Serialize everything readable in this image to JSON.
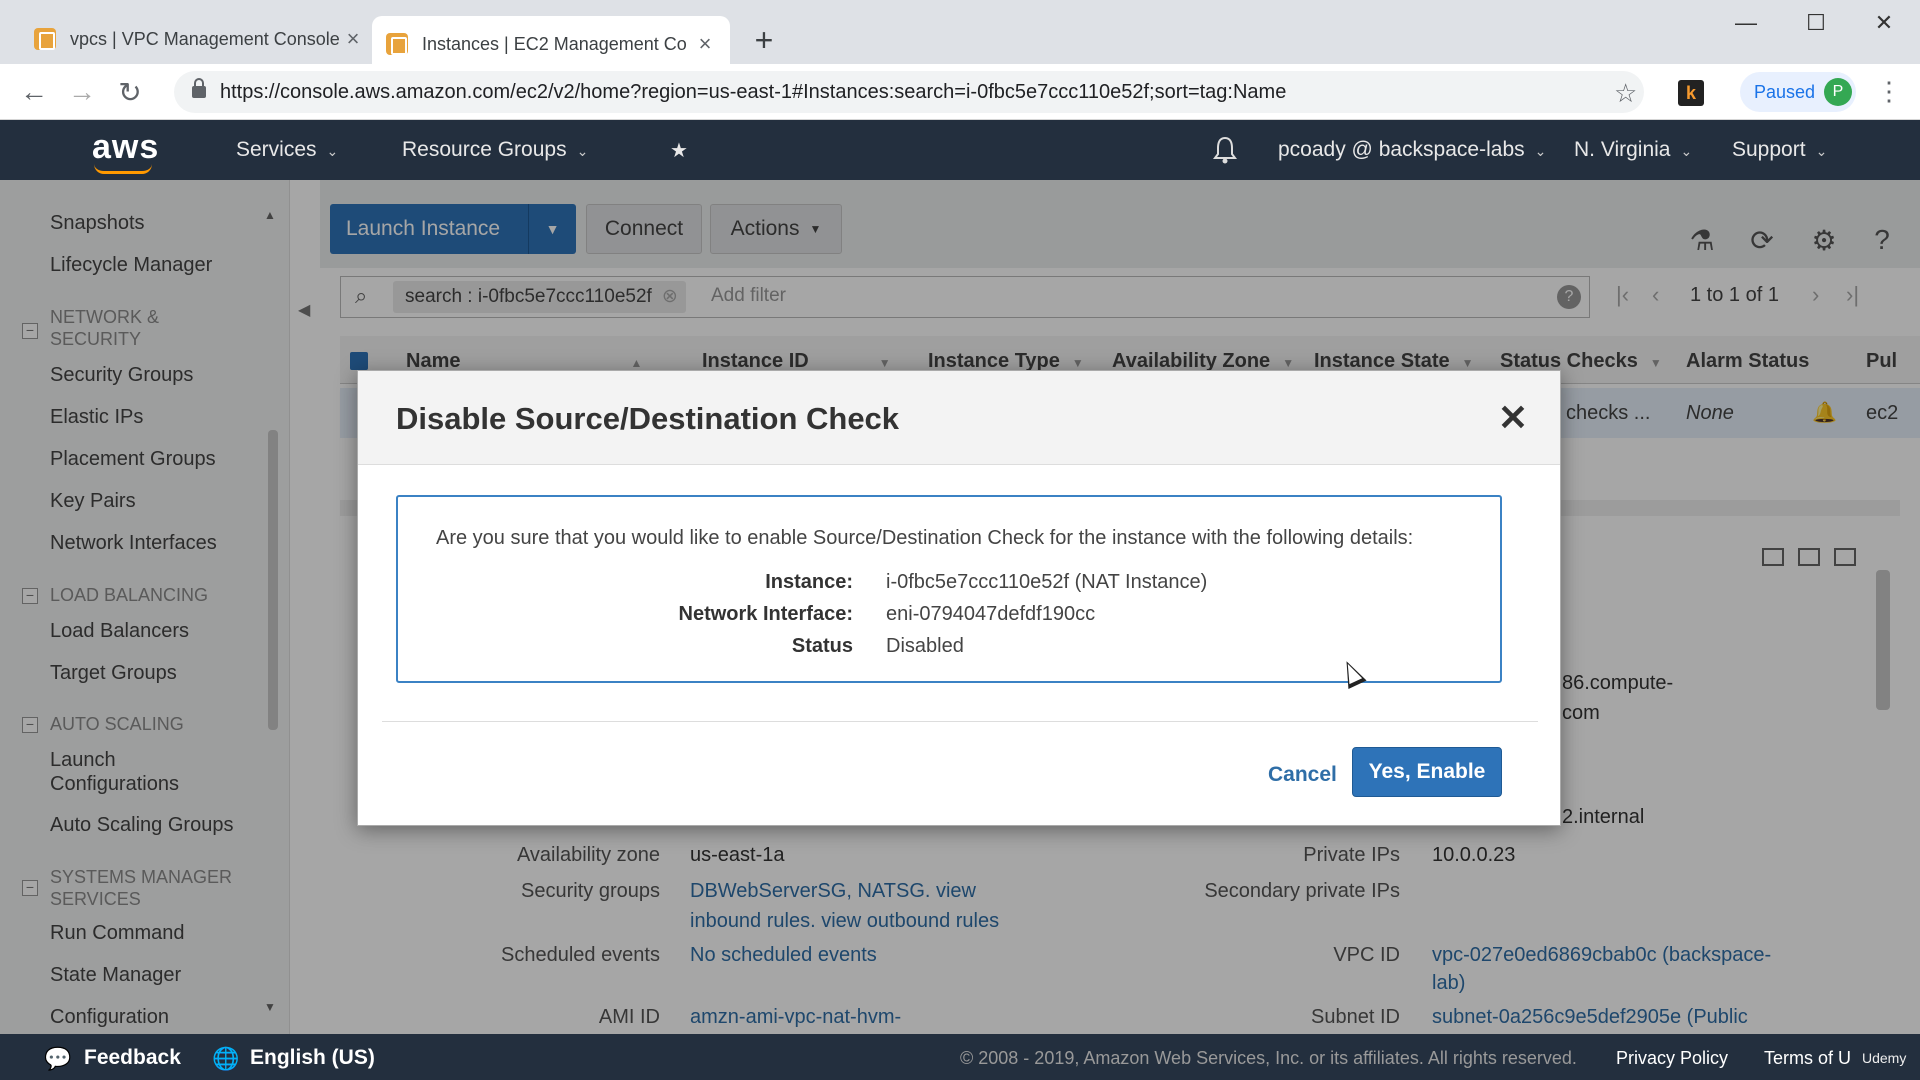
{
  "browser": {
    "tabs": [
      {
        "title": "vpcs | VPC Management Console"
      },
      {
        "title": "Instances | EC2 Management Co"
      }
    ],
    "url": "https://console.aws.amazon.com/ec2/v2/home?region=us-east-1#Instances:search=i-0fbc5e7ccc110e52f;sort=tag:Name",
    "profile_status": "Paused",
    "profile_initial": "P",
    "extension_letter": "k"
  },
  "aws_nav": {
    "logo": "aws",
    "services": "Services",
    "resource_groups": "Resource Groups",
    "account": "pcoady @ backspace-labs",
    "region": "N. Virginia",
    "support": "Support"
  },
  "sidebar": {
    "items_top": [
      "Snapshots",
      "Lifecycle Manager"
    ],
    "network_security": {
      "title": "NETWORK & SECURITY",
      "items": [
        "Security Groups",
        "Elastic IPs",
        "Placement Groups",
        "Key Pairs",
        "Network Interfaces"
      ]
    },
    "load_balancing": {
      "title": "LOAD BALANCING",
      "items": [
        "Load Balancers",
        "Target Groups"
      ]
    },
    "auto_scaling": {
      "title": "AUTO SCALING",
      "items": [
        "Launch Configurations",
        "Auto Scaling Groups"
      ]
    },
    "systems_manager": {
      "title": "SYSTEMS MANAGER SERVICES",
      "items": [
        "Run Command",
        "State Manager",
        "Configuration"
      ]
    }
  },
  "toolbar": {
    "launch_instance": "Launch Instance",
    "connect": "Connect",
    "actions": "Actions"
  },
  "filter": {
    "chip": "search : i-0fbc5e7ccc110e52f",
    "add_filter": "Add filter",
    "pagination": "1 to 1 of 1"
  },
  "table": {
    "columns": [
      "Name",
      "Instance ID",
      "Instance Type",
      "Availability Zone",
      "Instance State",
      "Status Checks",
      "Alarm Status",
      "Pul"
    ],
    "row": {
      "status_checks": "checks ...",
      "alarm_status": "None",
      "public": "ec2"
    }
  },
  "details": {
    "partial_right_top": "86.compute-",
    "partial_right_top2": "com",
    "partial_internal": "2.internal",
    "availability_zone_label": "Availability zone",
    "availability_zone": "us-east-1a",
    "security_groups_label": "Security groups",
    "security_groups": "DBWebServerSG, NATSG. view",
    "security_groups_links": "inbound rules. view outbound rules",
    "scheduled_events_label": "Scheduled events",
    "scheduled_events": "No scheduled events",
    "ami_label": "AMI ID",
    "ami": "amzn-ami-vpc-nat-hvm-",
    "private_ips_label": "Private IPs",
    "private_ips": "10.0.0.23",
    "secondary_private_ips_label": "Secondary private IPs",
    "vpc_id_label": "VPC ID",
    "vpc_id": "vpc-027e0ed6869cbab0c (backspace-",
    "vpc_id_2": "lab)",
    "subnet_label": "Subnet ID",
    "subnet": "subnet-0a256c9e5def2905e (Public"
  },
  "modal": {
    "title": "Disable Source/Destination Check",
    "question": "Are you sure that you would like to enable Source/Destination Check for the instance with the following details:",
    "fields": [
      {
        "label": "Instance:",
        "value": "i-0fbc5e7ccc110e52f (NAT Instance)"
      },
      {
        "label": "Network Interface:",
        "value": "eni-0794047defdf190cc"
      },
      {
        "label": "Status",
        "value": "Disabled"
      }
    ],
    "cancel": "Cancel",
    "confirm": "Yes, Enable"
  },
  "footer": {
    "feedback": "Feedback",
    "language": "English (US)",
    "copyright": "© 2008 - 2019, Amazon Web Services, Inc. or its affiliates. All rights reserved.",
    "privacy": "Privacy Policy",
    "terms": "Terms of U",
    "watermark": "Udemy"
  }
}
